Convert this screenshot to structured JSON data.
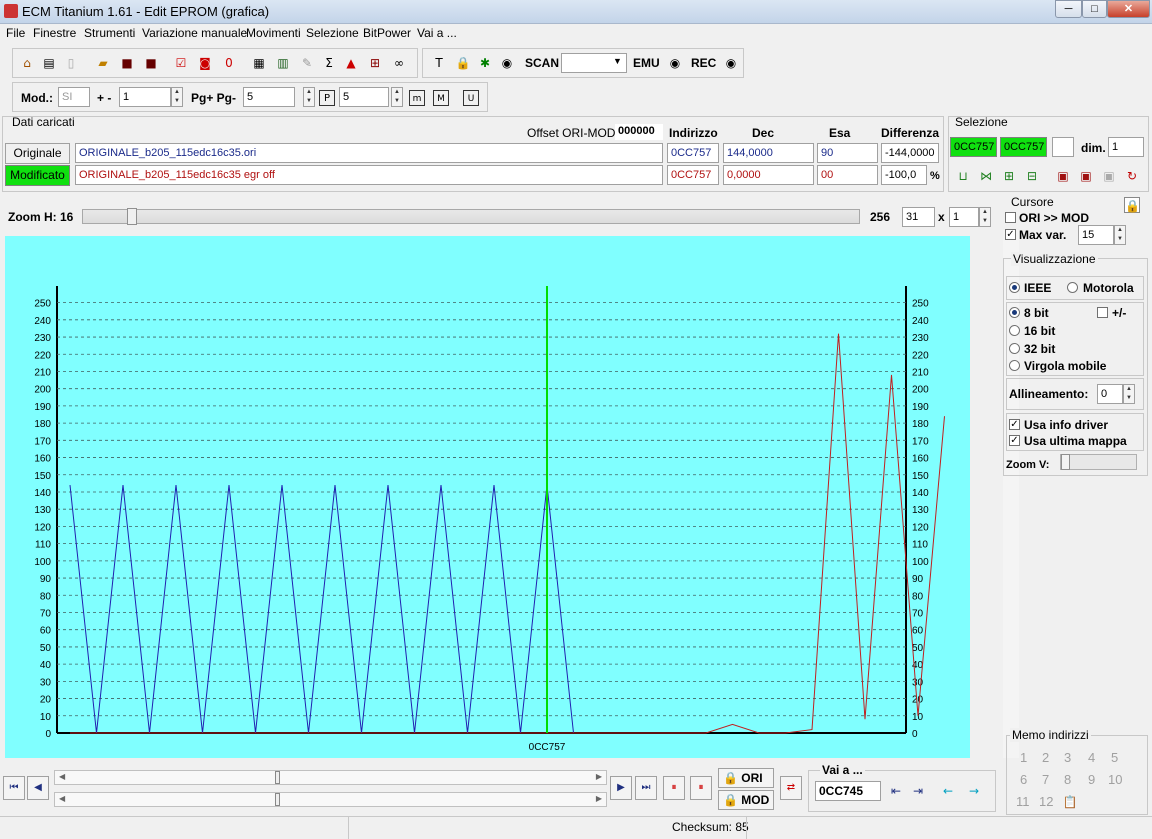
{
  "window": {
    "title": "ECM Titanium 1.61 - Edit EPROM (grafica)",
    "min": "─",
    "max": "□",
    "close": "✕"
  },
  "menu": [
    "File",
    "Finestre",
    "Strumenti",
    "Variazione manuale",
    "Movimenti",
    "Selezione",
    "BitPower",
    "Vai a ..."
  ],
  "toolbar": {
    "scan": "SCAN",
    "emu": "EMU",
    "rec": "REC",
    "scan_value": ""
  },
  "toolbar2": {
    "mod_label": "Mod.:",
    "mod_value": "SI",
    "plusminus": "+ -",
    "pm_value": "1",
    "pg_label": "Pg+ Pg-",
    "pg_value": "5",
    "p_value": "5"
  },
  "dati": {
    "title": "Dati caricati",
    "offset_label": "Offset ORI-MOD",
    "offset_value": "000000",
    "headers": {
      "indirizzo": "Indirizzo",
      "dec": "Dec",
      "esa": "Esa",
      "diff": "Differenza"
    },
    "originale": {
      "label": "Originale",
      "file": "ORIGINALE_b205_115edc16c35.ori",
      "addr": "0CC757",
      "dec": "144,0000",
      "esa": "90",
      "diff": "-144,0000"
    },
    "modificato": {
      "label": "Modificato",
      "file": "ORIGINALE_b205_115edc16c35 egr off",
      "addr": "0CC757",
      "dec": "0,0000",
      "esa": "00",
      "diff": "-100,0",
      "pct": "%"
    }
  },
  "selezione": {
    "title": "Selezione",
    "from": "0CC757",
    "to": "0CC757",
    "dim_label": "dim.",
    "dim_value": "1"
  },
  "zoom": {
    "label": "Zoom H: 16",
    "max": "256",
    "val1": "31",
    "x": "x",
    "val2": "1",
    "level": 0.0
  },
  "cursore": {
    "title": "Cursore",
    "ori_mod": "ORI >> MOD",
    "max_var": "Max var.",
    "max_var_value": "15",
    "ori_mod_checked": false,
    "max_var_checked": true
  },
  "visualizzazione": {
    "title": "Visualizzazione",
    "ieee": "IEEE",
    "motorola": "Motorola",
    "bit8": "8 bit",
    "plusminus": "+/-",
    "bit16": "16 bit",
    "bit32": "32 bit",
    "virgola": "Virgola mobile",
    "allineamento": "Allineamento:",
    "allineamento_value": "0",
    "usa_info": "Usa info driver",
    "usa_ultima": "Usa ultima mappa",
    "zoomv": "Zoom V:"
  },
  "memo": {
    "title": "Memo indirizzi",
    "items": [
      "1",
      "2",
      "3",
      "4",
      "5",
      "6",
      "7",
      "8",
      "9",
      "10",
      "11",
      "12"
    ]
  },
  "nav": {
    "ori": "ORI",
    "mod": "MOD",
    "vai_label": "Vai a ...",
    "vai_value": "0CC745"
  },
  "status": {
    "checksum": "Checksum: 85"
  },
  "chart_data": {
    "type": "line",
    "ylim": [
      0,
      255
    ],
    "yticks": [
      0,
      10,
      20,
      30,
      40,
      50,
      60,
      70,
      80,
      90,
      100,
      110,
      120,
      130,
      140,
      150,
      160,
      170,
      180,
      190,
      200,
      210,
      220,
      230,
      240,
      250
    ],
    "cursor_label": "0CC757",
    "cursor_index": 18,
    "colors": {
      "original": "#2020b0",
      "modified": "#c02020",
      "cursor": "#00dd00",
      "background": "#80ffff"
    },
    "series": [
      {
        "values": [
          144,
          0,
          144,
          0,
          144,
          0,
          144,
          0,
          144,
          0,
          144,
          0,
          144,
          0,
          144,
          0,
          144,
          0,
          144,
          0,
          null,
          null,
          null,
          null,
          null,
          null,
          null,
          null,
          null,
          null,
          null,
          null
        ]
      },
      {
        "values": [
          0,
          0,
          0,
          0,
          0,
          0,
          0,
          0,
          0,
          0,
          0,
          0,
          0,
          0,
          0,
          0,
          0,
          0,
          0,
          0,
          0,
          0,
          0,
          0,
          0,
          5,
          0,
          0,
          2,
          232,
          8,
          208,
          10,
          184
        ]
      }
    ],
    "x_count": 34
  }
}
